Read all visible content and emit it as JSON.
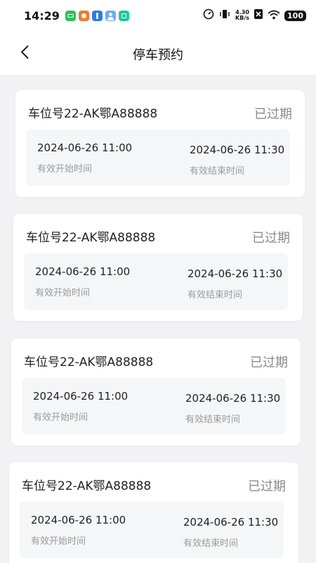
{
  "status_bar": {
    "time": "14:29",
    "net_speed_value": "4.30",
    "net_speed_unit": "KB/s",
    "battery": "100",
    "icons": [
      "app-notification-green-icon",
      "app-notification-orange-icon",
      "app-notification-blue-icon",
      "app-notification-avatar-icon",
      "app-notification-teal-icon",
      "speedometer-icon",
      "vibrate-icon",
      "sim-off-icon",
      "wifi-icon"
    ]
  },
  "header": {
    "title": "停车预约",
    "back_icon": "chevron-left-icon"
  },
  "reservations": [
    {
      "space": "车位号22-AK鄂A88888",
      "status": "已过期",
      "start_time": "2024-06-26 11:00",
      "start_label": "有效开始时间",
      "end_time": "2024-06-26 11:30",
      "end_label": "有效结束时间"
    },
    {
      "space": "车位号22-AK鄂A88888",
      "status": "已过期",
      "start_time": "2024-06-26 11:00",
      "start_label": "有效开始时间",
      "end_time": "2024-06-26 11:30",
      "end_label": "有效结束时间"
    },
    {
      "space": "车位号22-AK鄂A88888",
      "status": "已过期",
      "start_time": "2024-06-26 11:00",
      "start_label": "有效开始时间",
      "end_time": "2024-06-26 11:30",
      "end_label": "有效结束时间"
    },
    {
      "space": "车位号22-AK鄂A88888",
      "status": "已过期",
      "start_time": "2024-06-26 11:00",
      "start_label": "有效开始时间",
      "end_time": "2024-06-26 11:30",
      "end_label": "有效结束时间"
    }
  ],
  "colors": {
    "background": "#f2f2f4",
    "card": "#ffffff",
    "time_box": "#f5f6f7",
    "status_text": "#8a8a8a",
    "label_text": "#9a9a9a"
  }
}
